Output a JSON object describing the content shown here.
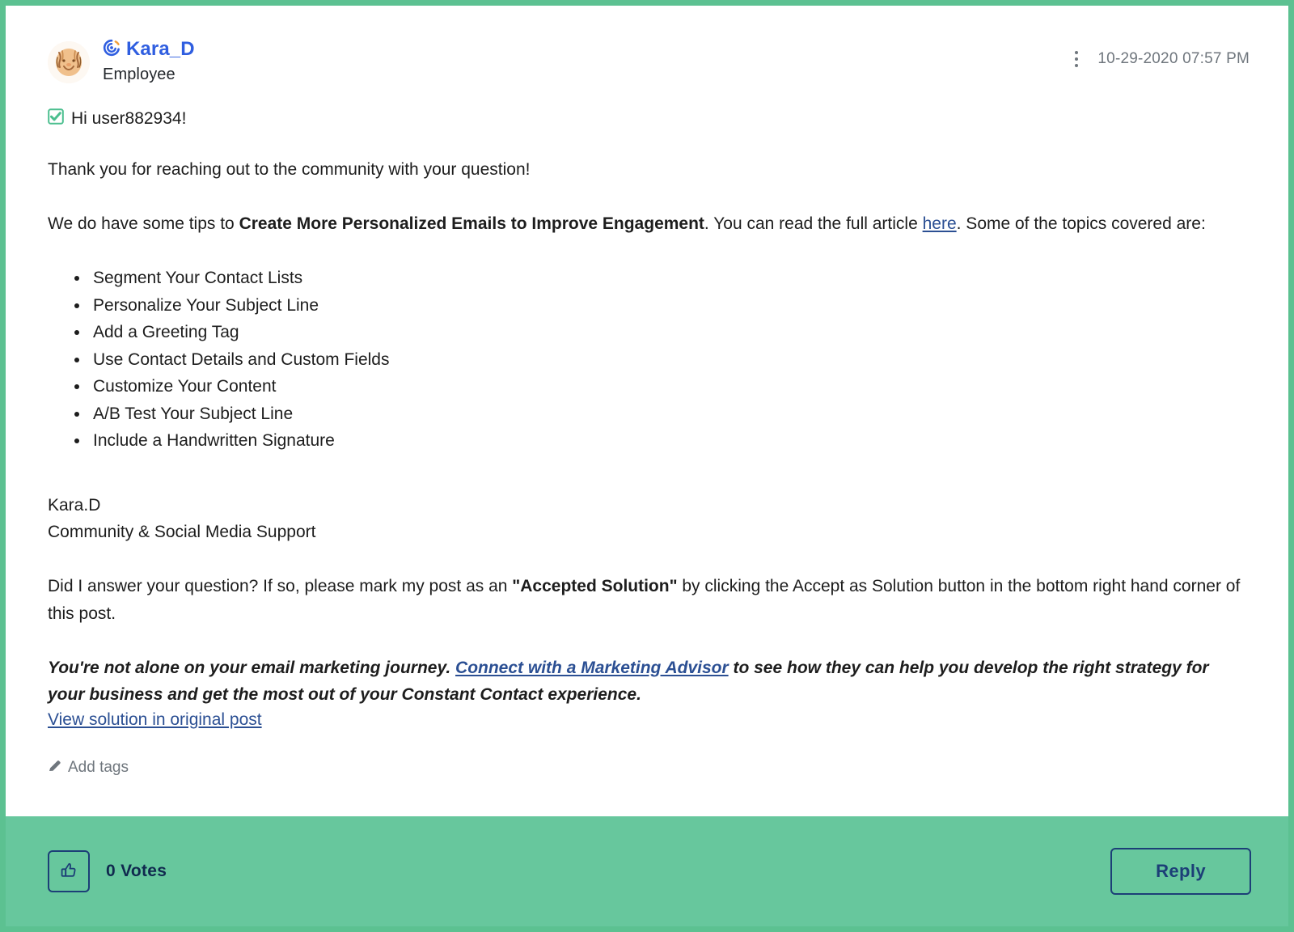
{
  "post": {
    "author": {
      "name": "Kara_D",
      "role": "Employee",
      "avatar_icon": "tiger-avatar",
      "badge_icon": "constant-contact-spiral-icon"
    },
    "timestamp": "10-29-2020 07:57 PM",
    "menu_icon": "kebab-menu-icon",
    "greeting": {
      "icon": "green-check-box-icon",
      "text": "Hi user882934!"
    },
    "paragraph_thanks": "Thank you for reaching out to the community with your question!",
    "tips_intro": {
      "lead": "We do have some tips to ",
      "bold": "Create More Personalized Emails to Improve Engagement",
      "middle": ". You can read the full article ",
      "link_text": "here",
      "tail": ".  Some of the topics covered are:"
    },
    "topics": [
      "Segment Your Contact Lists",
      "Personalize Your Subject Line",
      "Add a Greeting Tag",
      "Use Contact Details and Custom Fields",
      "Customize Your Content",
      "A/B Test Your Subject Line",
      "Include a Handwritten Signature"
    ],
    "signature": {
      "name": "Kara.D",
      "title": "Community & Social Media Support"
    },
    "accepted_solution": {
      "lead": "Did I answer your question? If so, please mark my post as an ",
      "bold": "\"Accepted Solution\"",
      "tail": " by clicking the Accept as Solution button in the bottom right hand corner of this post."
    },
    "promo": {
      "lead": "You're not alone on your email marketing journey. ",
      "link_text": "Connect with a Marketing Advisor",
      "tail": " to see how they can help you develop the right strategy for your business and get the most out of your Constant Contact experience."
    },
    "view_solution_link": "View solution in original post",
    "add_tags": {
      "icon": "pencil-icon",
      "label": "Add tags"
    }
  },
  "footer": {
    "kudos_icon": "thumbs-up-icon",
    "votes_label": "0 Votes",
    "reply_label": "Reply"
  },
  "colors": {
    "border": "#5cc191",
    "footer_bg": "#67c79d",
    "link": "#2b4f93",
    "author_name": "#2f5ee0",
    "button_outline": "#1c3f77",
    "muted_text": "#6f767d"
  }
}
